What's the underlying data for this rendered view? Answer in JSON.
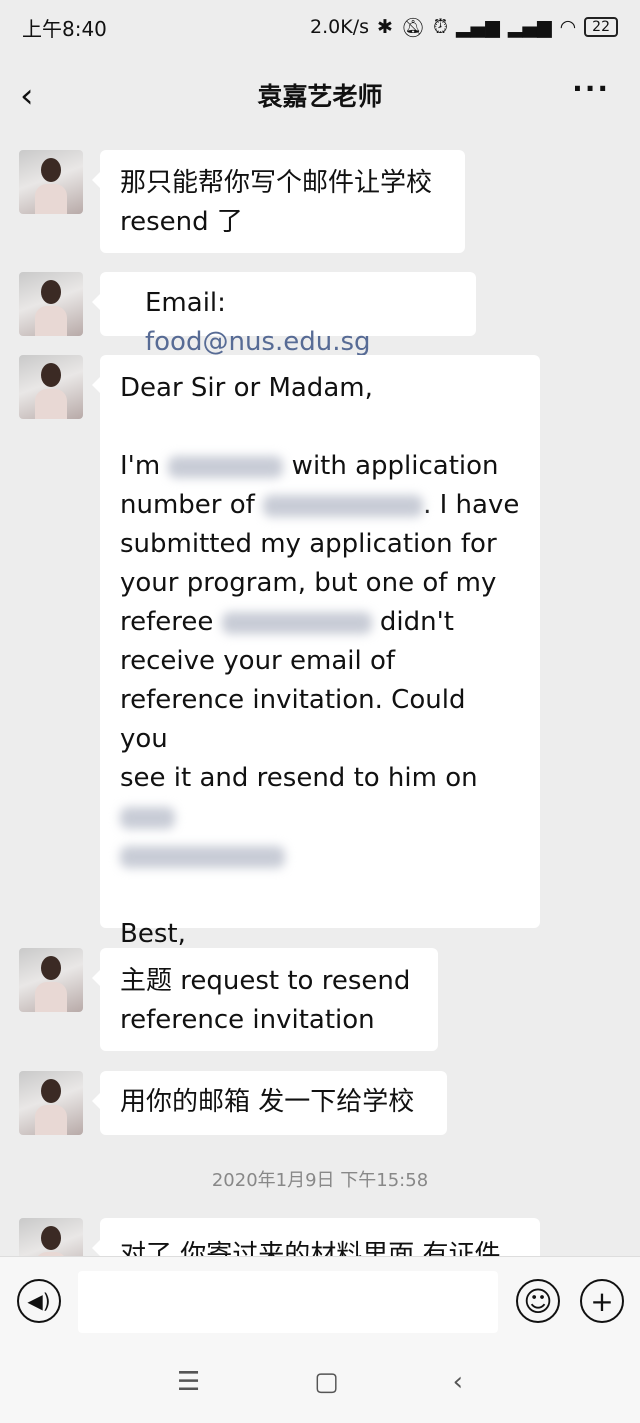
{
  "status": {
    "time": "上午8:40",
    "speed": "2.0K/s",
    "battery": "22"
  },
  "header": {
    "title": "袁嘉艺老师"
  },
  "messages": [
    {
      "text": "那只能帮你写个邮件让学校\nresend 了"
    },
    {
      "label": "Email: ",
      "email": "food@nus.edu.sg"
    },
    {
      "l1": "Dear Sir or Madam,",
      "l2a": "I'm ",
      "l2b": " with application",
      "l3a": "number of ",
      "l3b": ". I have",
      "l4": "submitted my application for",
      "l5": "your program, but one of my",
      "l6a": "referee ",
      "l6b": " didn't",
      "l7": "receive your email of",
      "l8": "reference invitation. Could you",
      "l9": "see it and resend to him on ",
      "l11": "Best,"
    },
    {
      "text": "主题 request to resend\nreference invitation"
    },
    {
      "text": "用你的邮箱 发一下给学校"
    },
    {
      "text": "对了 你寄过来的材料里面 有证件"
    }
  ],
  "timestamp": "2020年1月9日 下午15:58",
  "icons": {
    "voice": "voice-icon",
    "emoji": "emoji-icon",
    "plus": "plus-icon"
  }
}
